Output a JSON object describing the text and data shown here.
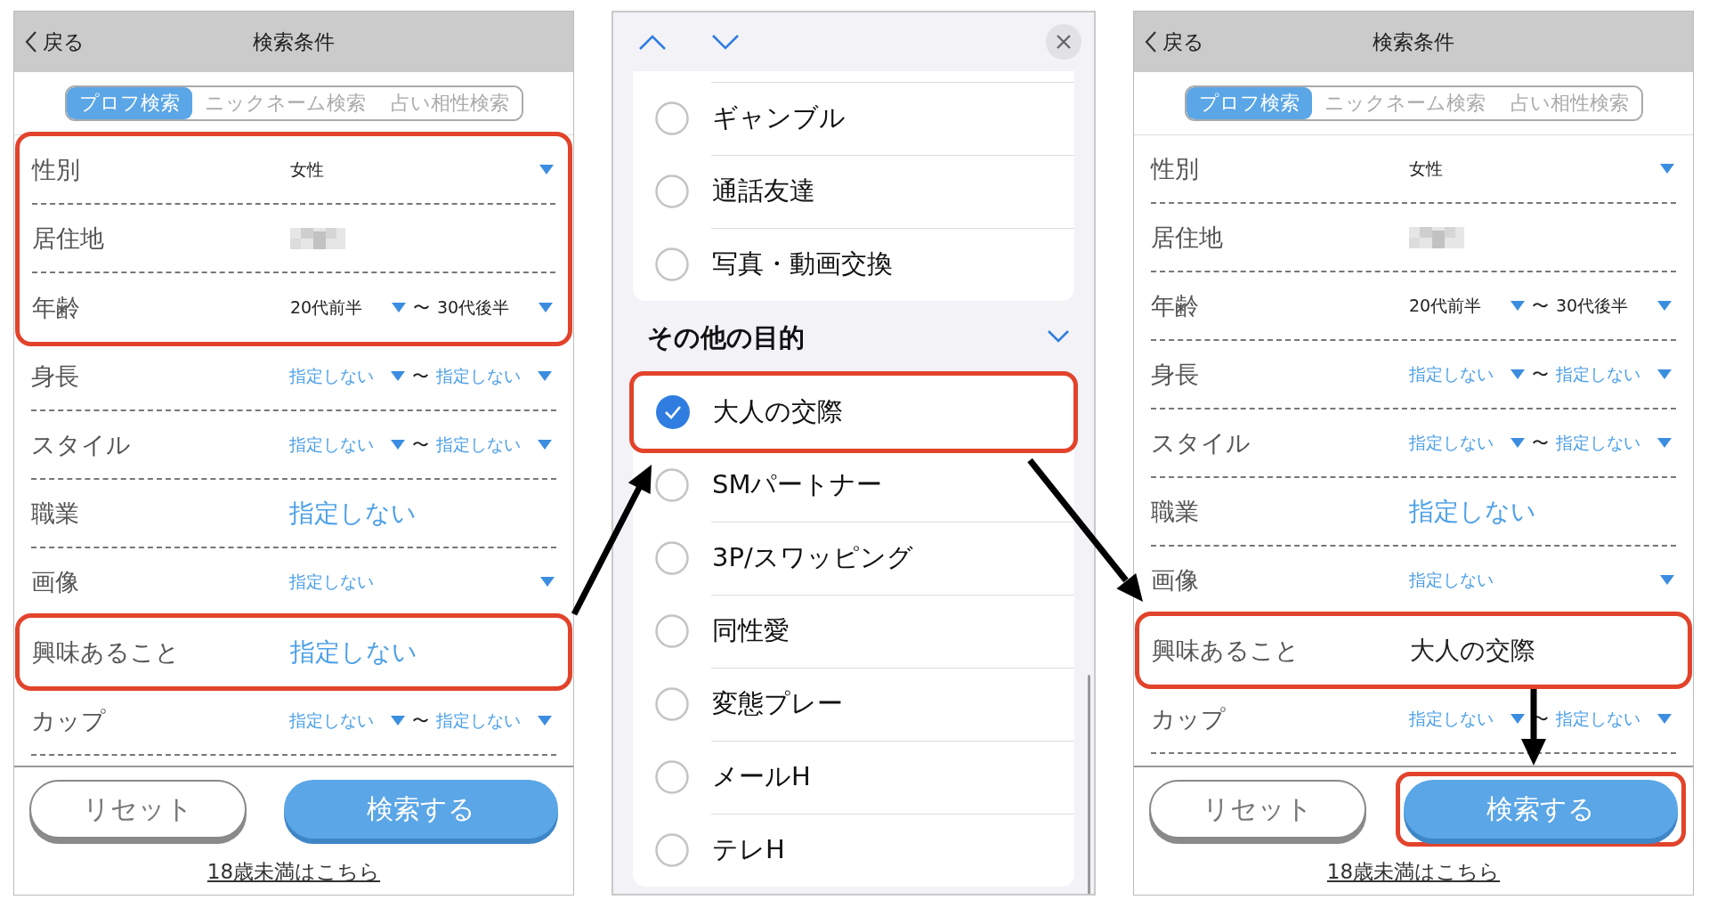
{
  "screens": [
    {
      "kind": "search_form",
      "back": "戻る",
      "title": "検索条件",
      "tabs": [
        {
          "label": "プロフ検索",
          "selected": true
        },
        {
          "label": "ニックネーム検索",
          "selected": false
        },
        {
          "label": "占い相性検索",
          "selected": false
        }
      ],
      "rows": [
        {
          "label": "性別",
          "kind": "select",
          "value": "女性",
          "specified": true,
          "highlighted": true
        },
        {
          "label": "居住地",
          "kind": "blurred",
          "highlighted": true
        },
        {
          "label": "年齢",
          "kind": "range",
          "from": "20代前半",
          "separator": "〜",
          "to": "30代後半",
          "specified": true,
          "highlighted": true
        },
        {
          "label": "身長",
          "kind": "range",
          "from": "指定しない",
          "separator": "〜",
          "to": "指定しない",
          "specified": false,
          "highlighted": false
        },
        {
          "label": "スタイル",
          "kind": "range",
          "from": "指定しない",
          "separator": "〜",
          "to": "指定しない",
          "specified": false,
          "highlighted": false
        },
        {
          "label": "職業",
          "kind": "text",
          "value": "指定しない",
          "specified": false,
          "highlighted": false
        },
        {
          "label": "画像",
          "kind": "select",
          "value": "指定しない",
          "specified": false,
          "highlighted": false
        },
        {
          "label": "興味あること",
          "kind": "text",
          "value": "指定しない",
          "specified": false,
          "highlighted": true
        },
        {
          "label": "カップ",
          "kind": "range",
          "from": "指定しない",
          "separator": "〜",
          "to": "指定しない",
          "specified": false,
          "highlighted": false
        }
      ],
      "buttons": [
        {
          "label": "リセット",
          "kind": "secondary",
          "highlighted": false
        },
        {
          "label": "検索する",
          "kind": "primary",
          "highlighted": false
        }
      ],
      "link": "18歳未満はこちら"
    },
    {
      "kind": "picker",
      "groups": [
        {
          "items": [
            {
              "label": "ギャンブル",
              "checked": false,
              "highlighted": false
            },
            {
              "label": "通話友達",
              "checked": false,
              "highlighted": false
            },
            {
              "label": "写真・動画交換",
              "checked": false,
              "highlighted": false
            }
          ]
        },
        {
          "title": "その他の目的",
          "expanded": true,
          "items": [
            {
              "label": "大人の交際",
              "checked": true,
              "highlighted": true
            },
            {
              "label": "SMパートナー",
              "checked": false,
              "highlighted": false
            },
            {
              "label": "3P/スワッピング",
              "checked": false,
              "highlighted": false
            },
            {
              "label": "同性愛",
              "checked": false,
              "highlighted": false
            },
            {
              "label": "変態プレー",
              "checked": false,
              "highlighted": false
            },
            {
              "label": "メールH",
              "checked": false,
              "highlighted": false
            },
            {
              "label": "テレH",
              "checked": false,
              "highlighted": false
            }
          ]
        }
      ]
    },
    {
      "kind": "search_form",
      "back": "戻る",
      "title": "検索条件",
      "tabs": [
        {
          "label": "プロフ検索",
          "selected": true
        },
        {
          "label": "ニックネーム検索",
          "selected": false
        },
        {
          "label": "占い相性検索",
          "selected": false
        }
      ],
      "rows": [
        {
          "label": "性別",
          "kind": "select",
          "value": "女性",
          "specified": true,
          "highlighted": false
        },
        {
          "label": "居住地",
          "kind": "blurred",
          "highlighted": false
        },
        {
          "label": "年齢",
          "kind": "range",
          "from": "20代前半",
          "separator": "〜",
          "to": "30代後半",
          "specified": true,
          "highlighted": false
        },
        {
          "label": "身長",
          "kind": "range",
          "from": "指定しない",
          "separator": "〜",
          "to": "指定しない",
          "specified": false,
          "highlighted": false
        },
        {
          "label": "スタイル",
          "kind": "range",
          "from": "指定しない",
          "separator": "〜",
          "to": "指定しない",
          "specified": false,
          "highlighted": false
        },
        {
          "label": "職業",
          "kind": "text",
          "value": "指定しない",
          "specified": false,
          "highlighted": false
        },
        {
          "label": "画像",
          "kind": "select",
          "value": "指定しない",
          "specified": false,
          "highlighted": false
        },
        {
          "label": "興味あること",
          "kind": "text",
          "value": "大人の交際",
          "specified": true,
          "highlighted": true
        },
        {
          "label": "カップ",
          "kind": "range",
          "from": "指定しない",
          "separator": "〜",
          "to": "指定しない",
          "specified": false,
          "highlighted": false
        }
      ],
      "buttons": [
        {
          "label": "リセット",
          "kind": "secondary",
          "highlighted": false
        },
        {
          "label": "検索する",
          "kind": "primary",
          "highlighted": true
        }
      ],
      "link": "18歳未満はこちら"
    }
  ]
}
